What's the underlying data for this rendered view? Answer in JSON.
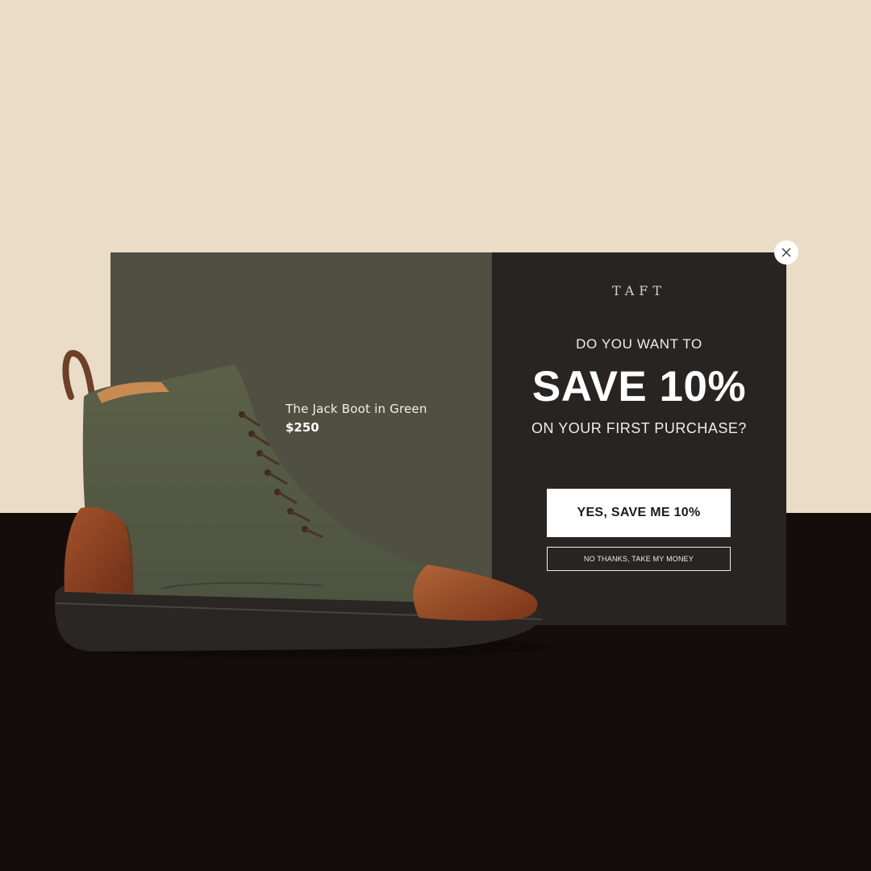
{
  "popup": {
    "brand_logo": "TAFT",
    "eyebrow": "DO YOU WANT TO",
    "headline": "SAVE 10%",
    "subline": "ON YOUR FIRST PURCHASE?",
    "accept_label": "YES, SAVE ME 10%",
    "decline_label": "NO THANKS, TAKE MY MONEY",
    "close_icon": "close-icon"
  },
  "product": {
    "name": "The Jack Boot in Green",
    "price": "$250",
    "image": "green-boot-image"
  },
  "colors": {
    "background_top": "#eadcc6",
    "background_bottom": "#140d0c",
    "panel_left": "#4f5041",
    "panel_right": "#282421",
    "accent_button": "#ffffff"
  }
}
